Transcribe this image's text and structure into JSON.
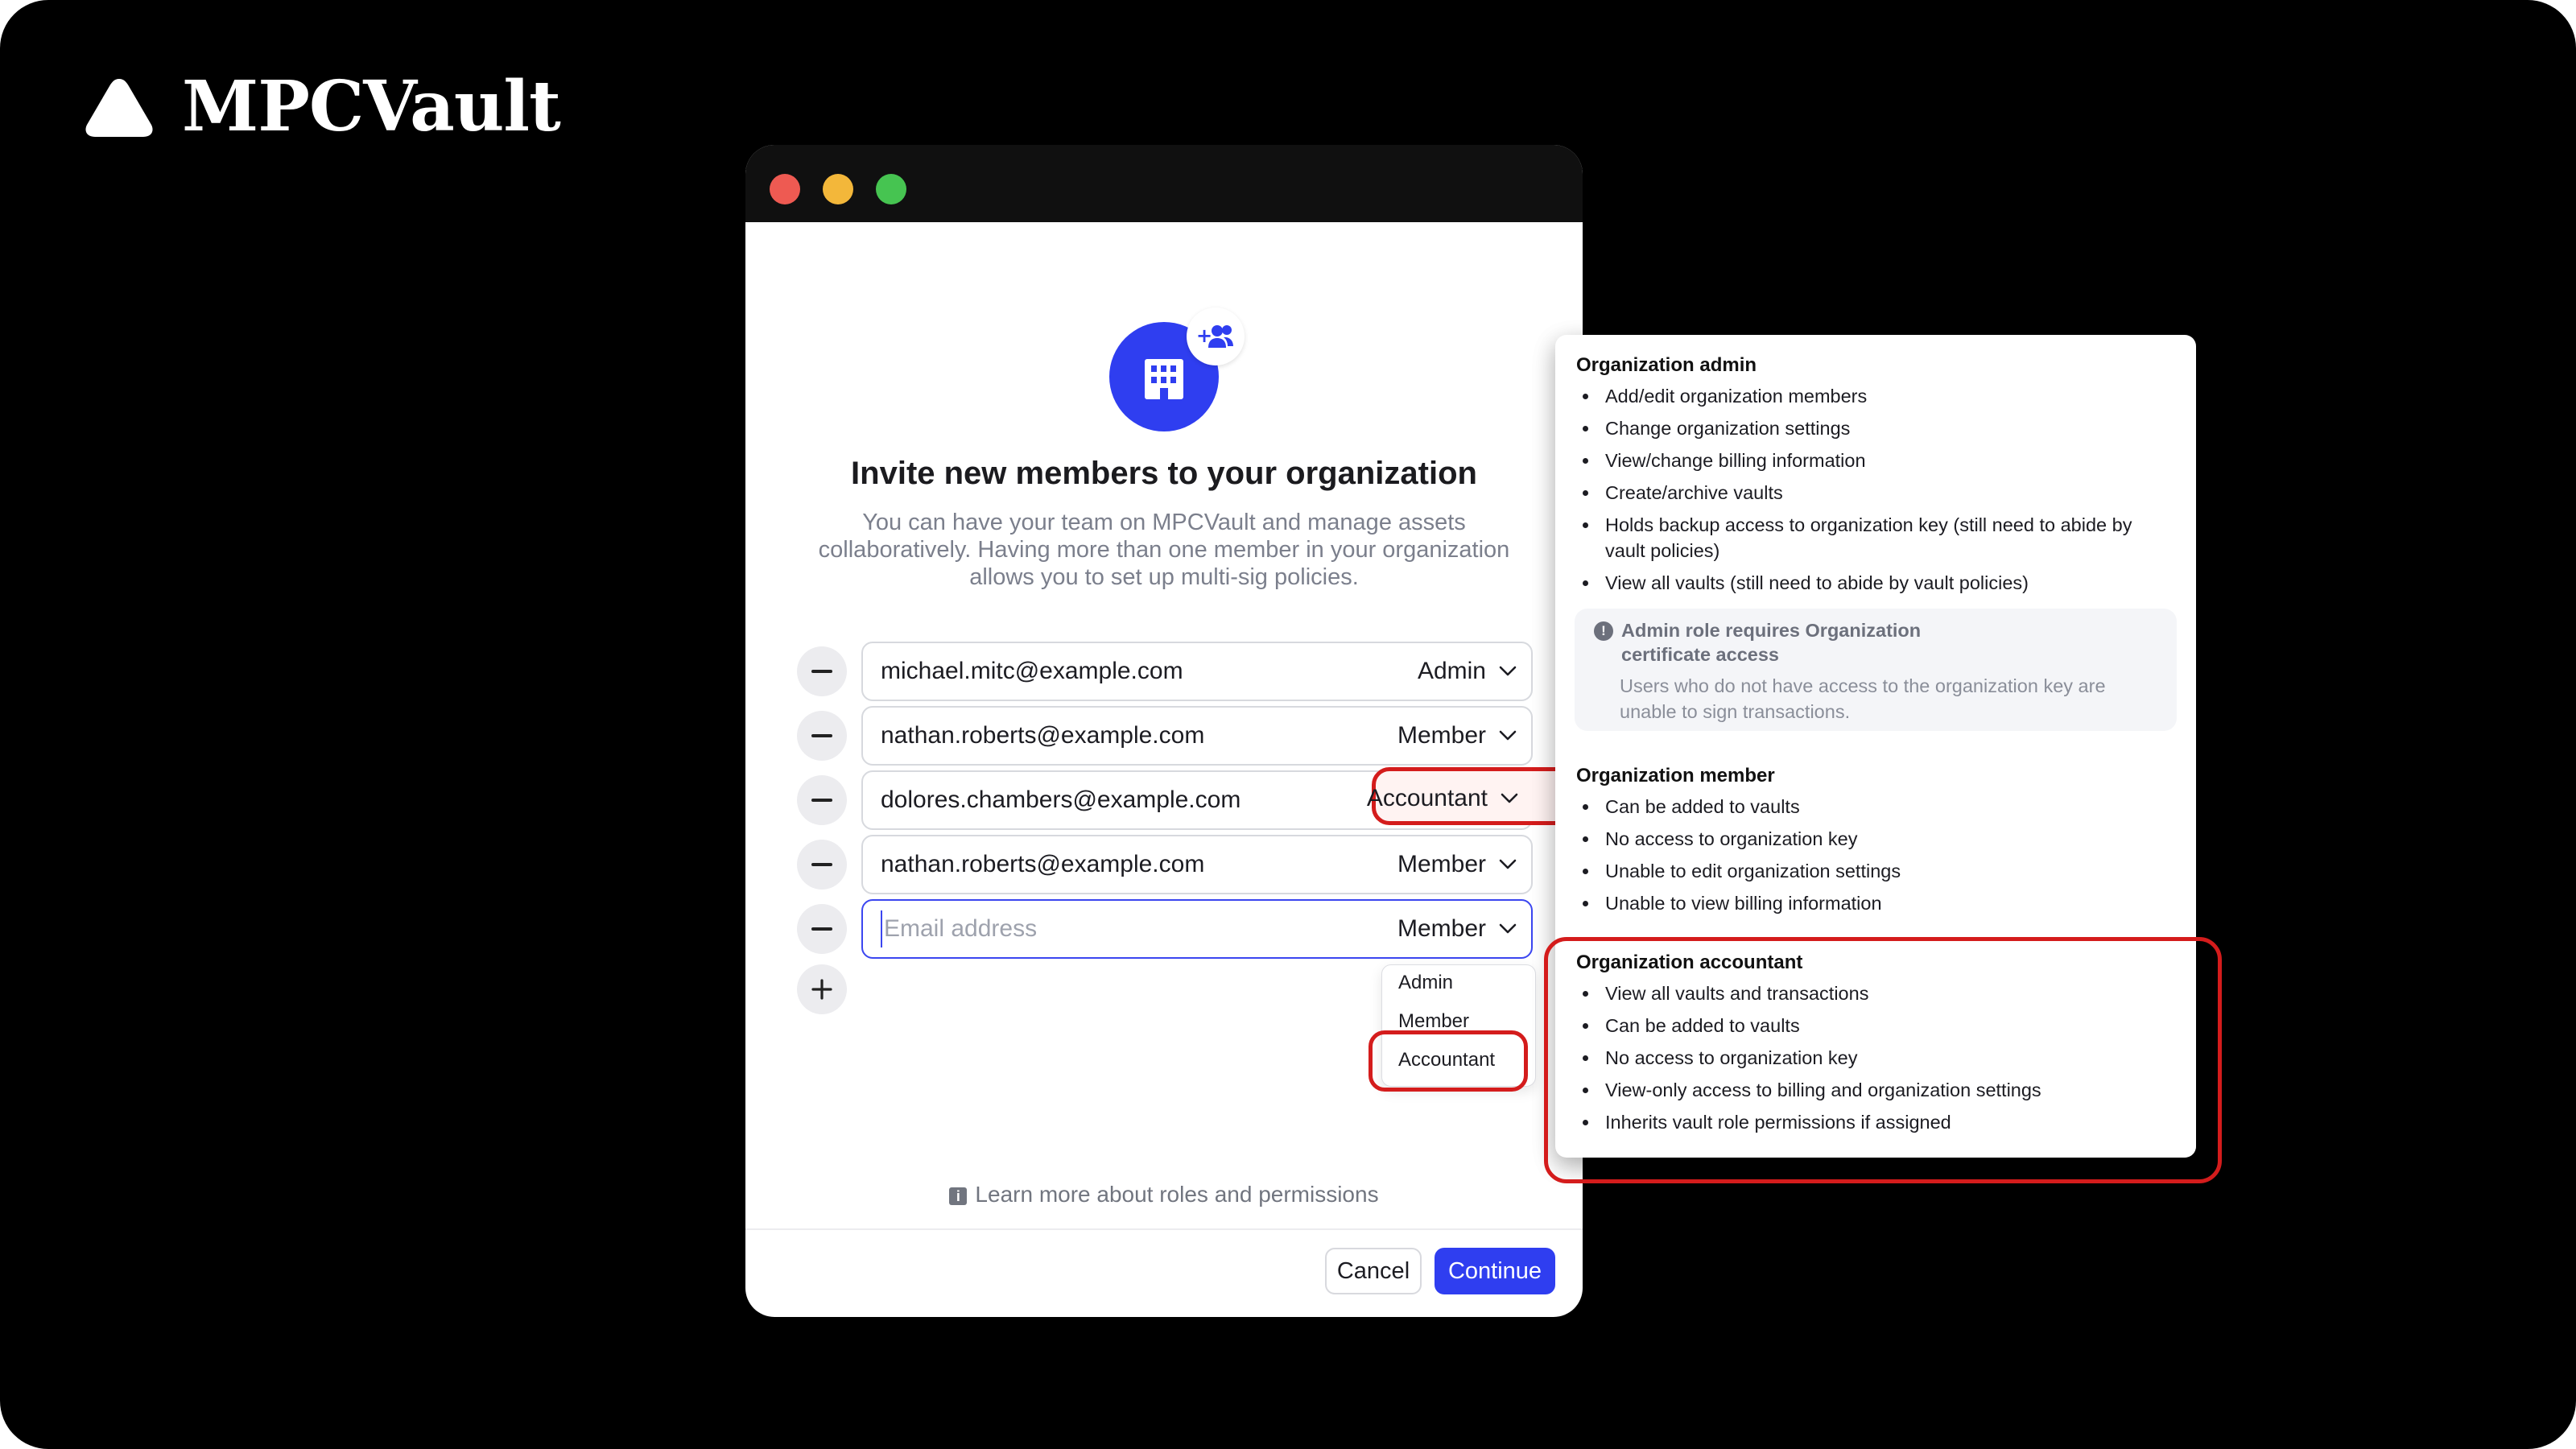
{
  "brand": {
    "name": "MPCVault",
    "logo_icon": "triangle-logo-icon"
  },
  "window": {
    "traffic_lights": [
      "close",
      "minimize",
      "zoom"
    ]
  },
  "invite": {
    "icon": "building-icon",
    "badge_icon": "add-users-icon",
    "title": "Invite new members to your organization",
    "description": "You can have your team on MPCVault and manage assets collaboratively. Having more than one member in your organization allows you to set up multi-sig policies.",
    "rows": [
      {
        "email": "michael.mitc@example.com",
        "role": "Admin"
      },
      {
        "email": "nathan.roberts@example.com",
        "role": "Member"
      },
      {
        "email": "dolores.chambers@example.com",
        "role": "Accountant",
        "highlighted": true
      },
      {
        "email": "nathan.roberts@example.com",
        "role": "Member"
      }
    ],
    "new_row": {
      "placeholder": "Email address",
      "role": "Member"
    },
    "role_options": [
      "Admin",
      "Member",
      "Accountant"
    ],
    "selected_option": "Accountant",
    "learn_more": "Learn more about roles and permissions",
    "cancel_label": "Cancel",
    "continue_label": "Continue"
  },
  "permissions": {
    "admin": {
      "title": "Organization admin",
      "items": [
        "Add/edit organization members",
        "Change organization settings",
        "View/change billing information",
        "Create/archive vaults",
        "Holds backup access to organization key (still need to abide by vault policies)",
        "View all vaults (still need to abide by vault policies)"
      ],
      "note_title": "Admin role requires Organization certificate access",
      "note_body": "Users who do not have access to the organization key are unable to sign transactions."
    },
    "member": {
      "title": "Organization member",
      "items": [
        "Can be added to vaults",
        "No access to organization key",
        "Unable to edit organization settings",
        "Unable to view billing information"
      ]
    },
    "accountant": {
      "title": "Organization accountant",
      "items": [
        "View all vaults and transactions",
        "Can be added to vaults",
        "No access to organization key",
        "View-only access to billing and organization settings",
        "Inherits vault role permissions if assigned"
      ]
    }
  },
  "colors": {
    "background": "#000000",
    "accent": "#2f3ef0",
    "highlight": "#d41c1c",
    "highlight_fill": "#fff3f2"
  }
}
